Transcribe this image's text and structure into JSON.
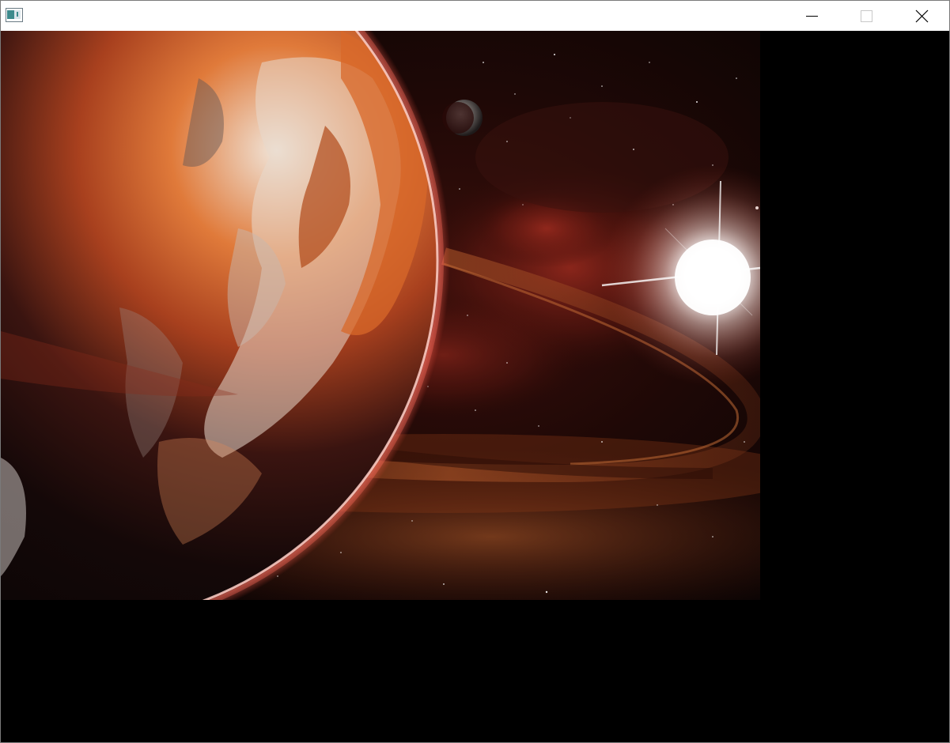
{
  "window": {
    "title": "",
    "icon": "application-window-icon"
  },
  "caption_buttons": {
    "minimize_icon": "minimize-icon",
    "maximize_icon": "maximize-icon",
    "close_icon": "close-icon"
  },
  "scene": {
    "description_icon": "space-scene-image",
    "colors": {
      "space": "#0a0404",
      "nebula": "#7a1e16",
      "ring": "#8a3a1e",
      "planet_glow": "#ff6a5a",
      "sun": "#ffffff"
    }
  }
}
